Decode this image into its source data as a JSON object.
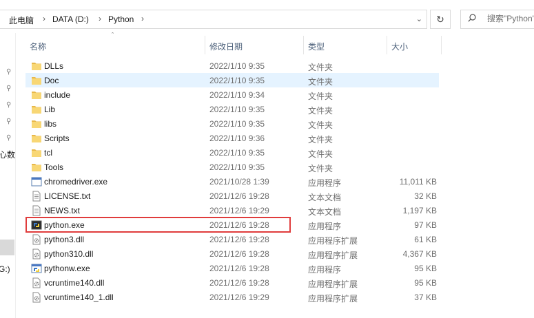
{
  "address_bar": {
    "breadcrumbs": [
      "此电脑",
      "DATA (D:)",
      "Python"
    ],
    "separator": "›"
  },
  "search": {
    "placeholder": "搜索\"Python\""
  },
  "nav_pane": {
    "partial_labels": [
      "心数",
      "G:)"
    ]
  },
  "columns": {
    "name": "名称",
    "date": "修改日期",
    "type": "类型",
    "size": "大小"
  },
  "files": [
    {
      "name": "DLLs",
      "date": "2022/1/10 9:35",
      "type": "文件夹",
      "size": "",
      "icon": "folder-icon"
    },
    {
      "name": "Doc",
      "date": "2022/1/10 9:35",
      "type": "文件夹",
      "size": "",
      "icon": "folder-icon",
      "selected": true
    },
    {
      "name": "include",
      "date": "2022/1/10 9:34",
      "type": "文件夹",
      "size": "",
      "icon": "folder-icon"
    },
    {
      "name": "Lib",
      "date": "2022/1/10 9:35",
      "type": "文件夹",
      "size": "",
      "icon": "folder-icon"
    },
    {
      "name": "libs",
      "date": "2022/1/10 9:35",
      "type": "文件夹",
      "size": "",
      "icon": "folder-icon"
    },
    {
      "name": "Scripts",
      "date": "2022/1/10 9:36",
      "type": "文件夹",
      "size": "",
      "icon": "folder-icon"
    },
    {
      "name": "tcl",
      "date": "2022/1/10 9:35",
      "type": "文件夹",
      "size": "",
      "icon": "folder-icon"
    },
    {
      "name": "Tools",
      "date": "2022/1/10 9:35",
      "type": "文件夹",
      "size": "",
      "icon": "folder-icon"
    },
    {
      "name": "chromedriver.exe",
      "date": "2021/10/28 1:39",
      "type": "应用程序",
      "size": "11,011 KB",
      "icon": "exe-window-icon"
    },
    {
      "name": "LICENSE.txt",
      "date": "2021/12/6 19:28",
      "type": "文本文档",
      "size": "32 KB",
      "icon": "text-file-icon"
    },
    {
      "name": "NEWS.txt",
      "date": "2021/12/6 19:29",
      "type": "文本文档",
      "size": "1,197 KB",
      "icon": "text-file-icon"
    },
    {
      "name": "python.exe",
      "date": "2021/12/6 19:28",
      "type": "应用程序",
      "size": "97 KB",
      "icon": "python-console-icon",
      "highlighted": true
    },
    {
      "name": "python3.dll",
      "date": "2021/12/6 19:28",
      "type": "应用程序扩展",
      "size": "61 KB",
      "icon": "dll-gear-icon"
    },
    {
      "name": "python310.dll",
      "date": "2021/12/6 19:28",
      "type": "应用程序扩展",
      "size": "4,367 KB",
      "icon": "dll-gear-icon"
    },
    {
      "name": "pythonw.exe",
      "date": "2021/12/6 19:28",
      "type": "应用程序",
      "size": "95 KB",
      "icon": "python-window-icon"
    },
    {
      "name": "vcruntime140.dll",
      "date": "2021/12/6 19:28",
      "type": "应用程序扩展",
      "size": "95 KB",
      "icon": "dll-gear-icon"
    },
    {
      "name": "vcruntime140_1.dll",
      "date": "2021/12/6 19:29",
      "type": "应用程序扩展",
      "size": "37 KB",
      "icon": "dll-gear-icon"
    }
  ],
  "colors": {
    "selected_row": "#e5f3ff",
    "highlight_border": "#e03c3c",
    "folder": "#f8d775",
    "header_text": "#4c607a"
  }
}
